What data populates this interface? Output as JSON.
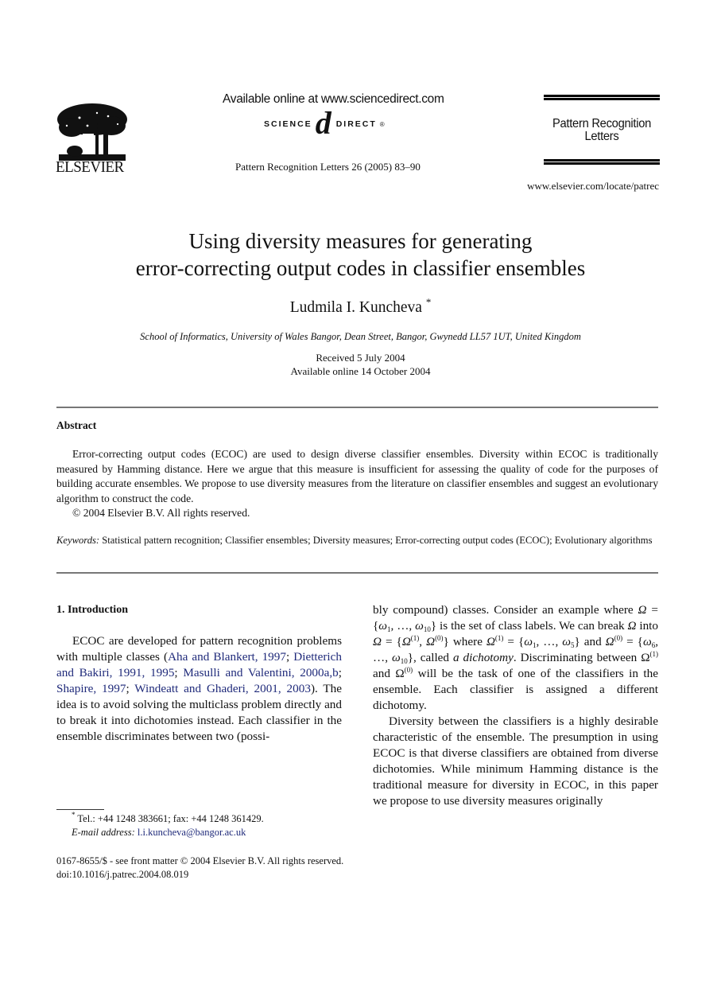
{
  "header": {
    "publisher": "ELSEVIER",
    "available_online": "Available online at www.sciencedirect.com",
    "sciencedirect_left": "SCIENCE",
    "sciencedirect_at": "d",
    "sciencedirect_right": "DIRECT",
    "sciencedirect_reg": "®",
    "journal_ref": "Pattern Recognition Letters 26 (2005) 83–90",
    "journal_name_line1": "Pattern Recognition",
    "journal_name_line2": "Letters",
    "journal_url": "www.elsevier.com/locate/patrec"
  },
  "article": {
    "title_line1": "Using diversity measures for generating",
    "title_line2": "error-correcting output codes in classifier ensembles",
    "author": "Ludmila I. Kuncheva",
    "author_mark": "*",
    "affiliation": "School of Informatics, University of Wales Bangor, Dean Street, Bangor, Gwynedd LL57 1UT, United Kingdom",
    "received": "Received 5 July 2004",
    "available": "Available online 14 October 2004"
  },
  "abstract": {
    "heading": "Abstract",
    "text": "Error-correcting output codes (ECOC) are used to design diverse classifier ensembles. Diversity within ECOC is traditionally measured by Hamming distance. Here we argue that this measure is insufficient for assessing the quality of code for the purposes of building accurate ensembles. We propose to use diversity measures from the literature on classifier ensembles and suggest an evolutionary algorithm to construct the code.",
    "copyright": "© 2004 Elsevier B.V. All rights reserved."
  },
  "keywords": {
    "label": "Keywords:",
    "text": "Statistical pattern recognition; Classifier ensembles; Diversity measures; Error-correcting output codes (ECOC); Evolutionary algorithms"
  },
  "intro": {
    "heading": "1. Introduction",
    "p1_start": "ECOC are developed for pattern recognition problems with multiple classes (",
    "citations": [
      "Aha and Blankert, 1997",
      "Dietterich and Bakiri, 1991, 1995",
      "Masulli and Valentini, 2000a,b",
      "Shapire, 1997",
      "Windeatt and Ghaderi, 2001, 2003"
    ],
    "sep": "; ",
    "p1_end": "). The idea is to avoid solving the multiclass problem directly and to break it into dichotomies instead. Each classifier in the ensemble discriminates between two (possibly compound) classes. Consider an example where ",
    "p1_math_1": "Ω = {ω",
    "p1_after_math_1": " is the set of class labels. We can break Ω into Ω = {Ω",
    "called": "called ",
    "dichotomy": "a dichotomy",
    "p1_tail": ". Discriminating between Ω",
    "p1_tail2": " and Ω",
    "p1_tail3": " will be the task of one of the classifiers in the ensemble. Each classifier is assigned a different dichotomy.",
    "p2": "Diversity between the classifiers is a highly desirable characteristic of the ensemble. The presumption in using ECOC is that diverse classifiers are obtained from diverse dichotomies. While minimum Hamming distance is the traditional measure for diversity in ECOC, in this paper we propose to use diversity measures originally"
  },
  "footnote": {
    "mark": "*",
    "contact": "Tel.: +44 1248 383661; fax: +44 1248 361429.",
    "email_label": "E-mail address:",
    "email": "l.i.kuncheva@bangor.ac.uk"
  },
  "footer": {
    "issn": "0167-8655/$ - see front matter  © 2004 Elsevier B.V. All rights reserved.",
    "doi": "doi:10.1016/j.patrec.2004.08.019"
  },
  "colors": {
    "link": "#1f2a7a",
    "rule": "#777777"
  }
}
